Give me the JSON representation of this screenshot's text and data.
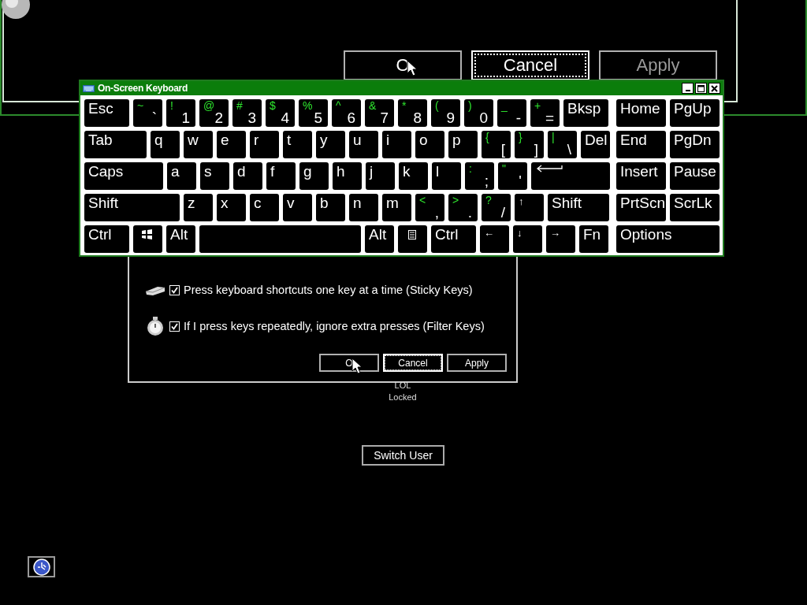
{
  "background_dialog": {
    "buttons": [
      {
        "label": "O",
        "focused": false,
        "disabled": false
      },
      {
        "label": "Cancel",
        "focused": true,
        "disabled": false
      },
      {
        "label": "Apply",
        "focused": false,
        "disabled": true
      }
    ]
  },
  "keyboard": {
    "title": "On-Screen Keyboard",
    "main_rows": [
      [
        {
          "kind": "char",
          "label": "Esc"
        },
        {
          "kind": "char",
          "label": "`",
          "shift": "~"
        },
        {
          "kind": "char",
          "label": "1",
          "shift": "!"
        },
        {
          "kind": "char",
          "label": "2",
          "shift": "@"
        },
        {
          "kind": "char",
          "label": "3",
          "shift": "#"
        },
        {
          "kind": "char",
          "label": "4",
          "shift": "$"
        },
        {
          "kind": "char",
          "label": "5",
          "shift": "%"
        },
        {
          "kind": "char",
          "label": "6",
          "shift": "^"
        },
        {
          "kind": "char",
          "label": "7",
          "shift": "&"
        },
        {
          "kind": "char",
          "label": "8",
          "shift": "*"
        },
        {
          "kind": "char",
          "label": "9",
          "shift": "("
        },
        {
          "kind": "char",
          "label": "0",
          "shift": ")"
        },
        {
          "kind": "char",
          "label": "-",
          "shift": "_"
        },
        {
          "kind": "char",
          "label": "=",
          "shift": "+"
        },
        {
          "kind": "char",
          "label": "Bksp"
        }
      ],
      [
        {
          "kind": "char",
          "label": "Tab"
        },
        {
          "kind": "char",
          "label": "q"
        },
        {
          "kind": "char",
          "label": "w"
        },
        {
          "kind": "char",
          "label": "e"
        },
        {
          "kind": "char",
          "label": "r"
        },
        {
          "kind": "char",
          "label": "t"
        },
        {
          "kind": "char",
          "label": "y"
        },
        {
          "kind": "char",
          "label": "u"
        },
        {
          "kind": "char",
          "label": "i"
        },
        {
          "kind": "char",
          "label": "o"
        },
        {
          "kind": "char",
          "label": "p"
        },
        {
          "kind": "char",
          "label": "[",
          "shift": "{"
        },
        {
          "kind": "char",
          "label": "]",
          "shift": "}"
        },
        {
          "kind": "char",
          "label": "\\",
          "shift": "|"
        },
        {
          "kind": "char",
          "label": "Del"
        }
      ],
      [
        {
          "kind": "char",
          "label": "Caps"
        },
        {
          "kind": "char",
          "label": "a"
        },
        {
          "kind": "char",
          "label": "s"
        },
        {
          "kind": "char",
          "label": "d"
        },
        {
          "kind": "char",
          "label": "f"
        },
        {
          "kind": "char",
          "label": "g"
        },
        {
          "kind": "char",
          "label": "h"
        },
        {
          "kind": "char",
          "label": "j"
        },
        {
          "kind": "char",
          "label": "k"
        },
        {
          "kind": "char",
          "label": "l"
        },
        {
          "kind": "char",
          "label": ";",
          "shift": ":"
        },
        {
          "kind": "char",
          "label": "'",
          "shift": "\""
        },
        {
          "kind": "enter"
        }
      ],
      [
        {
          "kind": "char",
          "label": "Shift"
        },
        {
          "kind": "char",
          "label": "z"
        },
        {
          "kind": "char",
          "label": "x"
        },
        {
          "kind": "char",
          "label": "c"
        },
        {
          "kind": "char",
          "label": "v"
        },
        {
          "kind": "char",
          "label": "b"
        },
        {
          "kind": "char",
          "label": "n"
        },
        {
          "kind": "char",
          "label": "m"
        },
        {
          "kind": "char",
          "label": ",",
          "shift": "<"
        },
        {
          "kind": "char",
          "label": ".",
          "shift": ">"
        },
        {
          "kind": "char",
          "label": "/",
          "shift": "?"
        },
        {
          "kind": "arrow",
          "label": "↑"
        },
        {
          "kind": "char",
          "label": "Shift"
        }
      ],
      [
        {
          "kind": "char",
          "label": "Ctrl"
        },
        {
          "kind": "windows"
        },
        {
          "kind": "char",
          "label": "Alt"
        },
        {
          "kind": "space"
        },
        {
          "kind": "char",
          "label": "Alt"
        },
        {
          "kind": "menu"
        },
        {
          "kind": "char",
          "label": "Ctrl"
        },
        {
          "kind": "arrow",
          "label": "←"
        },
        {
          "kind": "arrow",
          "label": "↓"
        },
        {
          "kind": "arrow",
          "label": "→"
        },
        {
          "kind": "char",
          "label": "Fn"
        }
      ]
    ],
    "side_rows": [
      [
        {
          "label": "Home"
        },
        {
          "label": "PgUp"
        }
      ],
      [
        {
          "label": "End"
        },
        {
          "label": "PgDn"
        }
      ],
      [
        {
          "label": "Insert"
        },
        {
          "label": "Pause"
        }
      ],
      [
        {
          "label": "PrtScn"
        },
        {
          "label": "ScrLk"
        }
      ],
      [
        {
          "label": "Options"
        }
      ]
    ]
  },
  "settings_dialog": {
    "options": [
      {
        "label": "Press keyboard shortcuts one key at a time (Sticky Keys)",
        "checked": true
      },
      {
        "label": "If I press keys repeatedly, ignore extra presses (Filter Keys)",
        "checked": true
      }
    ],
    "buttons": [
      {
        "label": "O",
        "focused": false
      },
      {
        "label": "Cancel",
        "focused": true
      },
      {
        "label": "Apply",
        "focused": false
      }
    ]
  },
  "user": {
    "name": "LOL",
    "status": "Locked"
  },
  "switch_user": {
    "label": "Switch User"
  }
}
